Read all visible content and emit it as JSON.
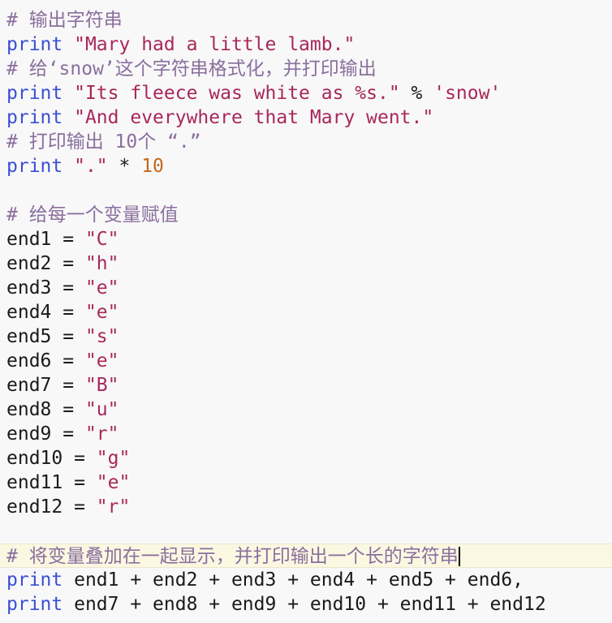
{
  "lines": [
    {
      "kind": "comment",
      "text": "# 输出字符串"
    },
    {
      "kind": "print_str",
      "kw": "print",
      "str": "\"Mary had a little lamb.\""
    },
    {
      "kind": "comment",
      "text": "# 给‘snow’这个字符串格式化，并打印输出"
    },
    {
      "kind": "print_fmt",
      "kw": "print",
      "str": "\"Its fleece was white as %s.\"",
      "op": " % ",
      "arg": "'snow'"
    },
    {
      "kind": "print_str",
      "kw": "print",
      "str": "\"And everywhere that Mary went.\""
    },
    {
      "kind": "comment",
      "text": "# 打印输出 10个 “.”"
    },
    {
      "kind": "print_mul",
      "kw": "print",
      "str": "\".\"",
      "op": " * ",
      "num": "10"
    },
    {
      "kind": "blank"
    },
    {
      "kind": "comment",
      "text": "# 给每一个变量赋值"
    },
    {
      "kind": "assign",
      "name": "end1",
      "value": "\"C\""
    },
    {
      "kind": "assign",
      "name": "end2",
      "value": "\"h\""
    },
    {
      "kind": "assign",
      "name": "end3",
      "value": "\"e\""
    },
    {
      "kind": "assign",
      "name": "end4",
      "value": "\"e\""
    },
    {
      "kind": "assign",
      "name": "end5",
      "value": "\"s\""
    },
    {
      "kind": "assign",
      "name": "end6",
      "value": "\"e\""
    },
    {
      "kind": "assign",
      "name": "end7",
      "value": "\"B\""
    },
    {
      "kind": "assign",
      "name": "end8",
      "value": "\"u\""
    },
    {
      "kind": "assign",
      "name": "end9",
      "value": "\"r\""
    },
    {
      "kind": "assign",
      "name": "end10",
      "value": "\"g\""
    },
    {
      "kind": "assign",
      "name": "end11",
      "value": "\"e\""
    },
    {
      "kind": "assign",
      "name": "end12",
      "value": "\"r\""
    },
    {
      "kind": "blank"
    },
    {
      "kind": "comment",
      "text": "# 将变量叠加在一起显示，并打印输出一个长的字符串",
      "current": true
    },
    {
      "kind": "print_expr",
      "kw": "print",
      "expr": " end1 + end2 + end3 + end4 + end5 + end6,"
    },
    {
      "kind": "print_expr",
      "kw": "print",
      "expr": " end7 + end8 + end9 + end10 + end11 + end12"
    }
  ]
}
